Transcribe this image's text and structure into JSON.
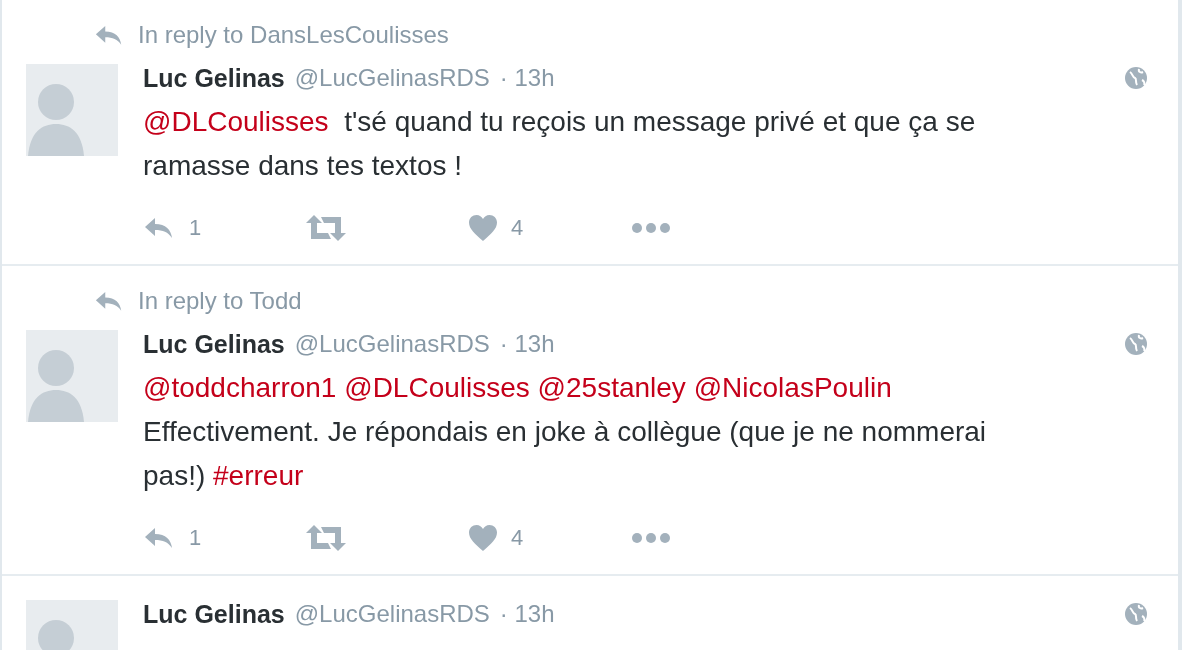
{
  "tweets": [
    {
      "reply_context": "In reply to DansLesCoulisses",
      "name": "Luc Gelinas",
      "handle": "@LucGelinasRDS",
      "time": "· 13h",
      "text": [
        {
          "kind": "mention",
          "text": "@DLCoulisses"
        },
        {
          "kind": "plain",
          "text": "  t'sé quand tu reçois un message privé et que ça se ramasse dans tes textos !"
        }
      ],
      "actions": {
        "replies": "1",
        "likes": "4"
      }
    },
    {
      "reply_context": "In reply to Todd",
      "name": "Luc Gelinas",
      "handle": "@LucGelinasRDS",
      "time": "· 13h",
      "text": [
        {
          "kind": "mention",
          "text": "@toddcharron1 @DLCoulisses @25stanley @NicolasPoulin"
        },
        {
          "kind": "plain",
          "text": " Effectivement. Je répondais en joke à collègue (que je ne nommerai pas!) "
        },
        {
          "kind": "mention",
          "text": "#erreur"
        }
      ],
      "actions": {
        "replies": "1",
        "likes": "4"
      }
    },
    {
      "name": "Luc Gelinas",
      "handle": "@LucGelinasRDS",
      "time": "· 13h"
    }
  ]
}
